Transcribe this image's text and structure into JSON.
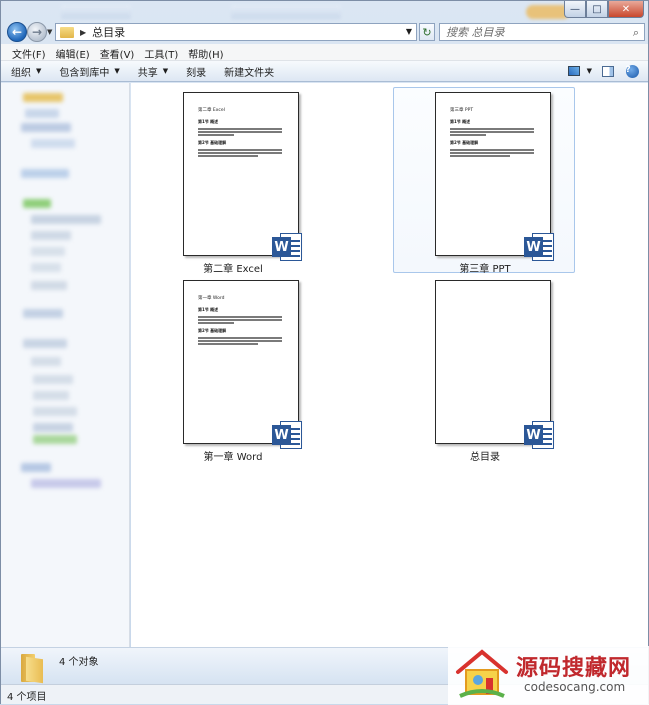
{
  "address": {
    "path": "总目录",
    "search_placeholder": "搜索 总目录"
  },
  "window": {
    "controls": {
      "minimize": "—",
      "maximize": "□",
      "close": "✕"
    }
  },
  "menu": [
    "文件(F)",
    "编辑(E)",
    "查看(V)",
    "工具(T)",
    "帮助(H)"
  ],
  "toolbar": {
    "organize": "组织",
    "include_in_library": "包含到库中",
    "share": "共享",
    "burn": "刻录",
    "new_folder": "新建文件夹"
  },
  "files": [
    {
      "name": "第二章 Excel",
      "selected": false,
      "preview": {
        "title": "第二章  Excel",
        "sections": [
          "第1节 概述",
          "第2节 基础理解"
        ]
      }
    },
    {
      "name": "第三章 PPT",
      "selected": true,
      "preview": {
        "title": "第三章  PPT",
        "sections": [
          "第1节 概述",
          "第2节 基础理解"
        ]
      }
    },
    {
      "name": "第一章 Word",
      "selected": false,
      "preview": {
        "title": "第一章  Word",
        "sections": [
          "第1节 概述",
          "第2节 基础理解"
        ]
      }
    },
    {
      "name": "总目录",
      "selected": false,
      "preview": null
    }
  ],
  "details": {
    "count": "4 个对象"
  },
  "status": {
    "text": "4 个项目"
  },
  "watermark": {
    "title": "源码搜藏网",
    "url": "codesocang.com"
  },
  "colors": {
    "word_blue": "#2b5797",
    "selection_border": "#a9c7eb",
    "watermark_red": "#c0282d"
  }
}
